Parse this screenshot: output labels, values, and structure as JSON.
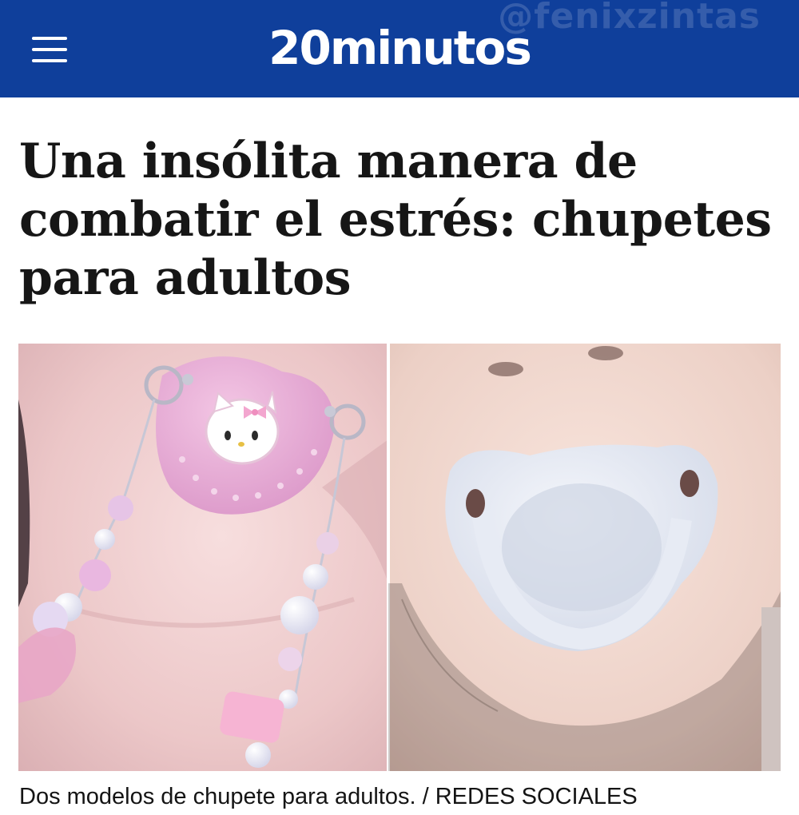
{
  "header": {
    "logo": "20minutos",
    "watermark": "@fenixzintas",
    "menu_icon": "hamburger-menu-icon",
    "background_color": "#0f3f9b"
  },
  "article": {
    "headline": "Una insólita manera de combatir el estrés: chupetes para adultos",
    "image_caption": "Dos modelos de chupete para adultos. / REDES SOCIALES"
  }
}
